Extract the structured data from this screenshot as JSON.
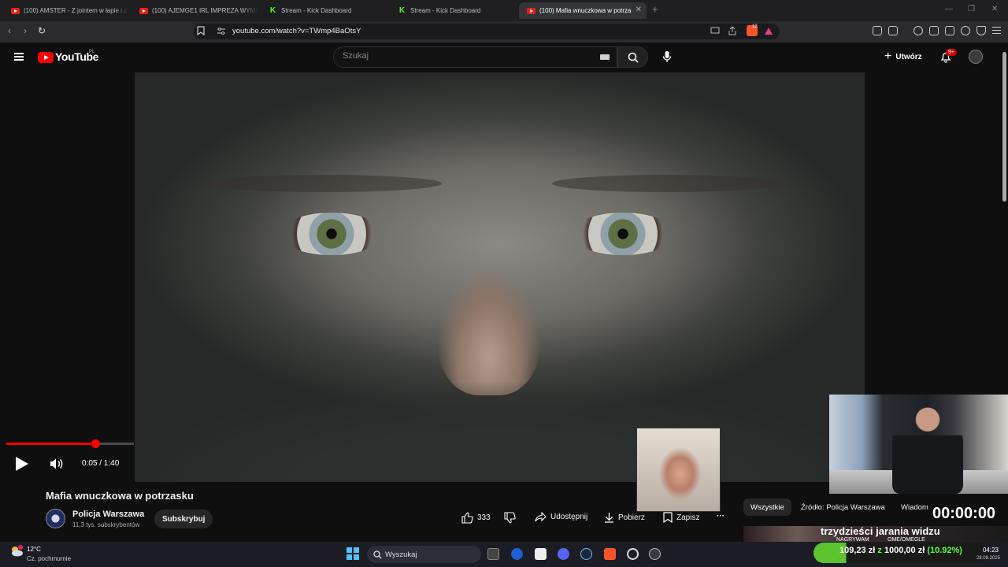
{
  "browser": {
    "tabs": [
      {
        "label": "(100) AMSTER - Z jointem w łapie i z",
        "icon": "youtube-icon",
        "active": false
      },
      {
        "label": "(100) AJEMGE1 IRL IMPREZA WYMK",
        "icon": "youtube-icon",
        "active": false
      },
      {
        "label": "Stream - Kick Dashboard",
        "icon": "kick-icon",
        "active": false
      },
      {
        "label": "Stream - Kick Dashboard",
        "icon": "kick-icon",
        "active": false
      },
      {
        "label": "(100) Mafia wnuczkowa w potrza",
        "icon": "youtube-icon",
        "active": true
      }
    ],
    "new_tab": "+",
    "url": "youtube.com/watch?v=TWmp4BaOtsY",
    "brave_badge": "12",
    "window_controls": {
      "minimize": "—",
      "restore": "❐",
      "close": "✕"
    }
  },
  "youtube": {
    "logo_text": "YouTube",
    "region": "PL",
    "search_placeholder": "Szukaj",
    "create_label": "Utwórz",
    "notifications_badge": "9+"
  },
  "player": {
    "current_time": "0:05",
    "duration": "1:40",
    "time_display": "0:05 / 1:40",
    "progress": 0.05
  },
  "video": {
    "title": "Mafia wnuczkowa w potrzasku",
    "channel_name": "Policja Warszawa",
    "subscribers": "11,3 tys. subskrybentów",
    "subscribe_label": "Subskrybuj",
    "likes": "333",
    "share_label": "Udostępnij",
    "download_label": "Pobierz",
    "save_label": "Zapisz",
    "more_label": "···"
  },
  "chips": [
    {
      "label": "Wszystkie",
      "selected": true
    },
    {
      "label": "Źródło: Policja Warszawa",
      "selected": false
    },
    {
      "label": "Wiadom",
      "selected": false
    }
  ],
  "overlay": {
    "timer": "00:00:00",
    "headline": "trzydzieści jarania widzu",
    "sub_left": "NAGRYWAM",
    "sub_right": "OME/OMEGLE"
  },
  "taskbar": {
    "temperature": "12°C",
    "condition": "Cz. pochmurnie",
    "search_label": "Wyszukaj",
    "donation": {
      "raised": "109,23 zł",
      "separator": "z",
      "goal": "1000,00 zł",
      "percent": "(10.92%)",
      "fraction": 0.1092
    },
    "time": "04:23",
    "date": "28.08.2025"
  },
  "colors": {
    "youtube_red": "#ff0000",
    "kick_green": "#53fc18",
    "donation_green": "#5cc42e",
    "background": "#0f0f0f"
  }
}
